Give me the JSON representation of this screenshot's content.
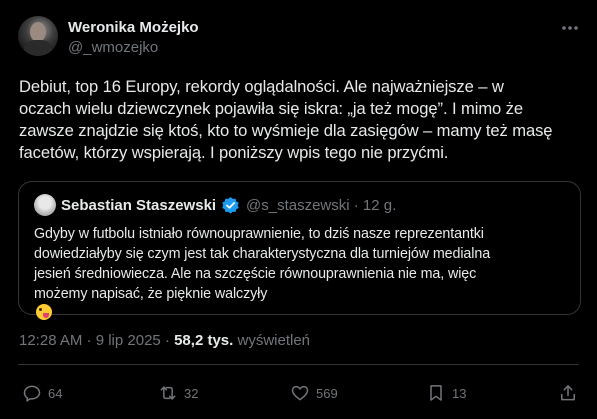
{
  "author": {
    "name": "Weronika Możejko",
    "handle": "@_wmozejko"
  },
  "tweet_lines": [
    "Debiut, top 16 Europy, rekordy oglądalności. Ale najważniejsze – w",
    "oczach wielu dziewczynek pojawiła się iskra: „ja też mogę”. I mimo że",
    "zawsze znajdzie się ktoś, kto to wyśmieje dla zasięgów – mamy też masę",
    "facetów, którzy wspierają. I poniższy wpis tego nie przyćmi."
  ],
  "quote": {
    "name": "Sebastian Staszewski",
    "meta": "@s_staszewski · 12 g.",
    "lines": [
      "Gdyby w futbolu istniało równouprawnienie, to dziś nasze reprezentantki",
      "dowiedziałyby się czym jest tak charakterystyczna dla turniejów medialna",
      "jesień średniowiecza. Ale na szczęście równouprawnienia nie ma, więc",
      "możemy napisać, że pięknie walczyły"
    ]
  },
  "meta": {
    "time": "12:28 AM · 9 lip 2025 · ",
    "views": "58,2 tys.",
    "views_label": " wyświetleń"
  },
  "actions": {
    "replies": "64",
    "reposts": "32",
    "likes": "569",
    "bookmarks": "13"
  },
  "colors": {
    "background": "#000000",
    "text": "#e7e9ea",
    "muted": "#71767b",
    "verified": "#1d9bf0",
    "border": "#333639"
  }
}
